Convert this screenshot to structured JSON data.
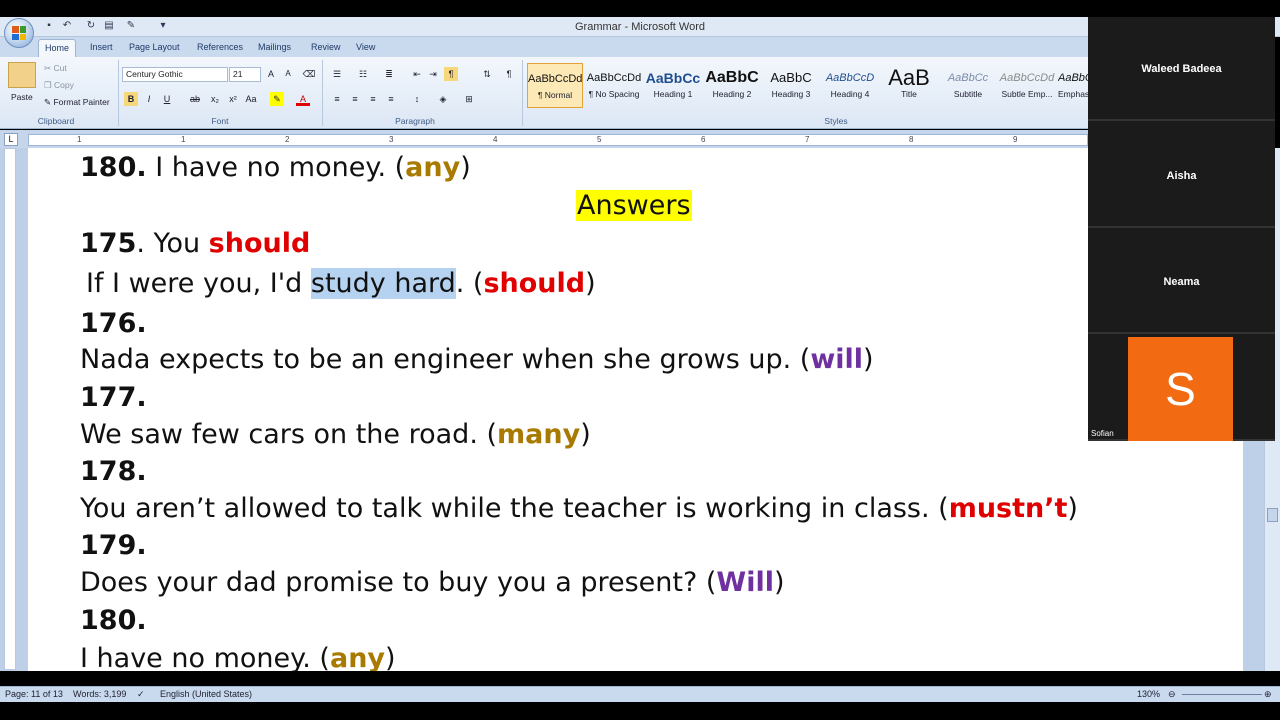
{
  "window": {
    "title": "Grammar - Microsoft Word"
  },
  "tabs": [
    "Home",
    "Insert",
    "Page Layout",
    "References",
    "Mailings",
    "Review",
    "View"
  ],
  "clipboard": {
    "paste": "Paste",
    "cut": "Cut",
    "copy": "Copy",
    "format_painter": "Format Painter",
    "label": "Clipboard"
  },
  "font": {
    "name": "Century Gothic",
    "size": "21",
    "label": "Font"
  },
  "paragraph": {
    "label": "Paragraph"
  },
  "styles": {
    "label": "Styles",
    "items": [
      {
        "preview": "AaBbCcDd",
        "name": "¶ Normal"
      },
      {
        "preview": "AaBbCcDd",
        "name": "¶ No Spacing"
      },
      {
        "preview": "AaBbCc",
        "name": "Heading 1"
      },
      {
        "preview": "AaBbC",
        "name": "Heading 2"
      },
      {
        "preview": "AaBbC",
        "name": "Heading 3"
      },
      {
        "preview": "AaBbCcD",
        "name": "Heading 4"
      },
      {
        "preview": "AaB",
        "name": "Title"
      },
      {
        "preview": "AaBbCc",
        "name": "Subtitle"
      },
      {
        "preview": "AaBbCcDd",
        "name": "Subtle Emp..."
      },
      {
        "preview": "AaBbCcD",
        "name": "Emphasis"
      }
    ]
  },
  "ruler": {
    "numbers": [
      "1",
      "1",
      "2",
      "3",
      "4",
      "5",
      "6",
      "7",
      "8",
      "9"
    ]
  },
  "document": {
    "l1": {
      "num": "180.",
      "text": " I have no money. (",
      "kw": "any",
      "end": ")"
    },
    "answers": "Answers",
    "l2": {
      "num": "175",
      "text": ". You ",
      "kw": "should"
    },
    "l3": {
      "a": "If I were you, I'd ",
      "sel": "study hard",
      "b": ". (",
      "kw": "should",
      "end": ")"
    },
    "n176": "176.",
    "l176": {
      "text": "Nada expects to be an engineer when she grows up. (",
      "kw": "will",
      "end": ")"
    },
    "n177": "177.",
    "l177": {
      "text": "We saw few cars on the road. (",
      "kw": "many",
      "end": ")"
    },
    "n178": "178.",
    "l178": {
      "text": "You aren’t allowed to talk while the teacher is working in class. (",
      "kw": "mustn’t",
      "end": ")"
    },
    "n179": "179.",
    "l179": {
      "text": "Does your dad promise to buy you a present? (",
      "kw": "Will",
      "end": ")"
    },
    "n180": "180.",
    "l180": {
      "text": "I have no money. (",
      "kw": "any",
      "end": ")"
    }
  },
  "status": {
    "page": "Page: 11 of 13",
    "words": "Words: 3,199",
    "language": "English (United States)",
    "zoom": "130%"
  },
  "participants": [
    {
      "name": "Waleed Badeea"
    },
    {
      "name": "Aisha"
    },
    {
      "name": "Neama"
    },
    {
      "name": "Sofian",
      "initial": "S",
      "color": "#f26b13"
    }
  ]
}
